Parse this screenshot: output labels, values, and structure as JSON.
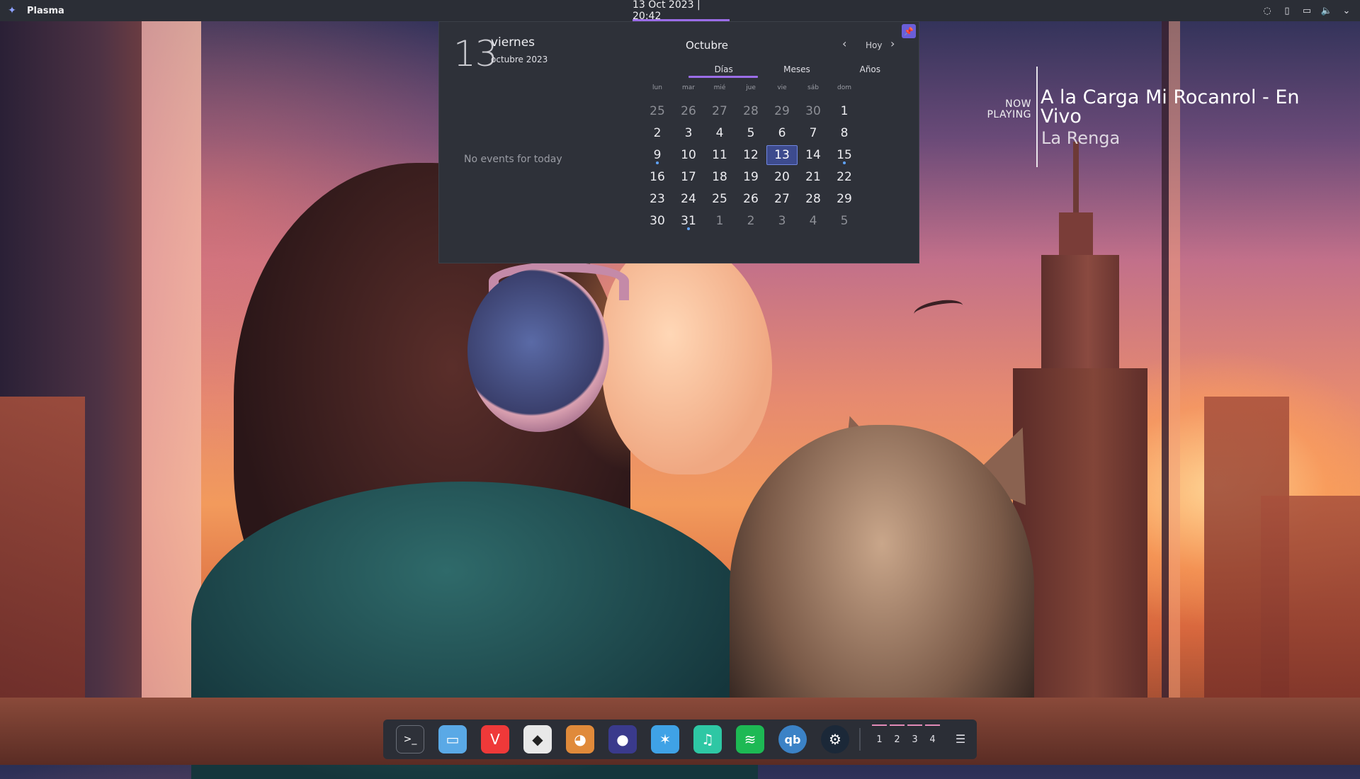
{
  "topbar": {
    "app_name": "Plasma",
    "clock": "13 Oct 2023 | 20:42"
  },
  "calendar": {
    "day_number": "13",
    "weekday": "viernes",
    "month_year": "octubre 2023",
    "no_events": "No events for today",
    "month_name": "Octubre",
    "today_button": "Hoy",
    "tabs": [
      "Días",
      "Meses",
      "Años"
    ],
    "weekday_headers": [
      "lun",
      "mar",
      "mié",
      "jue",
      "vie",
      "sáb",
      "dom"
    ],
    "weeks": [
      [
        "25",
        "26",
        "27",
        "28",
        "29",
        "30",
        "1"
      ],
      [
        "2",
        "3",
        "4",
        "5",
        "6",
        "7",
        "8"
      ],
      [
        "9",
        "10",
        "11",
        "12",
        "13",
        "14",
        "15"
      ],
      [
        "16",
        "17",
        "18",
        "19",
        "20",
        "21",
        "22"
      ],
      [
        "23",
        "24",
        "25",
        "26",
        "27",
        "28",
        "29"
      ],
      [
        "30",
        "31",
        "1",
        "2",
        "3",
        "4",
        "5"
      ]
    ],
    "today": "13",
    "event_days": [
      "9",
      "15",
      "31"
    ]
  },
  "now_playing": {
    "label": "NOW PLAYING",
    "title": "A la Carga Mi Rocanrol - En Vivo",
    "artist": "La Renga"
  },
  "dock": {
    "apps": [
      {
        "name": "terminal-icon",
        "glyph": ">_",
        "bg": "#2e3139"
      },
      {
        "name": "files-icon",
        "glyph": "▭",
        "bg": "#5aa9e6"
      },
      {
        "name": "vivaldi-icon",
        "glyph": "V",
        "bg": "#ef3939"
      },
      {
        "name": "inkscape-icon",
        "glyph": "◆",
        "bg": "#e8e8e8"
      },
      {
        "name": "gimp-icon",
        "glyph": "◕",
        "bg": "#e08a3a"
      },
      {
        "name": "obs-icon",
        "glyph": "●",
        "bg": "#3a3a8c"
      },
      {
        "name": "kdeconnect-icon",
        "glyph": "✶",
        "bg": "#3fa2e6"
      },
      {
        "name": "music-icon",
        "glyph": "♫",
        "bg": "#2ec7a4"
      },
      {
        "name": "spotify-icon",
        "glyph": "≋",
        "bg": "#1db954"
      },
      {
        "name": "qbittorrent-icon",
        "glyph": "qb",
        "bg": "#3b82c6"
      },
      {
        "name": "steam-icon",
        "glyph": "⚙",
        "bg": "#1b2838"
      }
    ],
    "pager": [
      "1",
      "2",
      "3",
      "4"
    ]
  }
}
